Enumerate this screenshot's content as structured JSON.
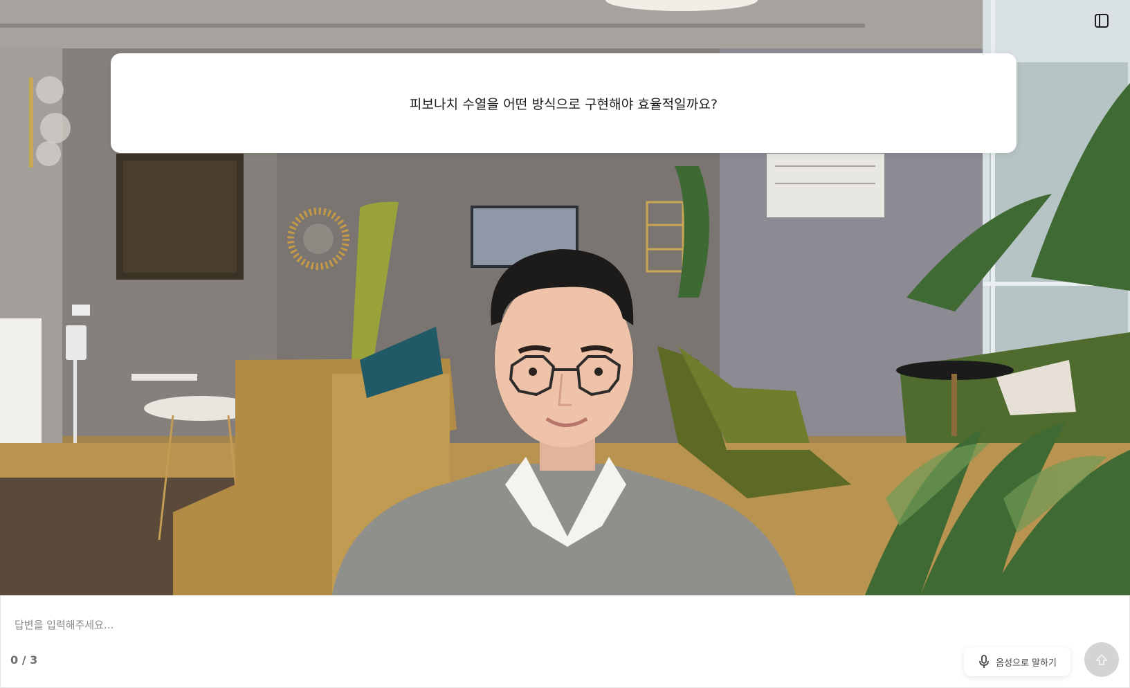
{
  "question": {
    "text": "피보나치 수열을 어떤 방식으로 구현해야 효율적일까요?"
  },
  "answer": {
    "placeholder": "답변을 입력해주세요...",
    "value": ""
  },
  "progress": {
    "counter": "0 / 3"
  },
  "actions": {
    "voice_label": "음성으로 말하기",
    "voice_icon": "microphone-icon",
    "send_icon": "arrow-up-icon",
    "toggle_icon": "sidebar-toggle-icon"
  },
  "colors": {
    "card_bg": "#ffffff",
    "send_disabled": "#d4d4d4",
    "counter_text": "#6f6f6f",
    "placeholder_text": "#8a8a8a"
  }
}
